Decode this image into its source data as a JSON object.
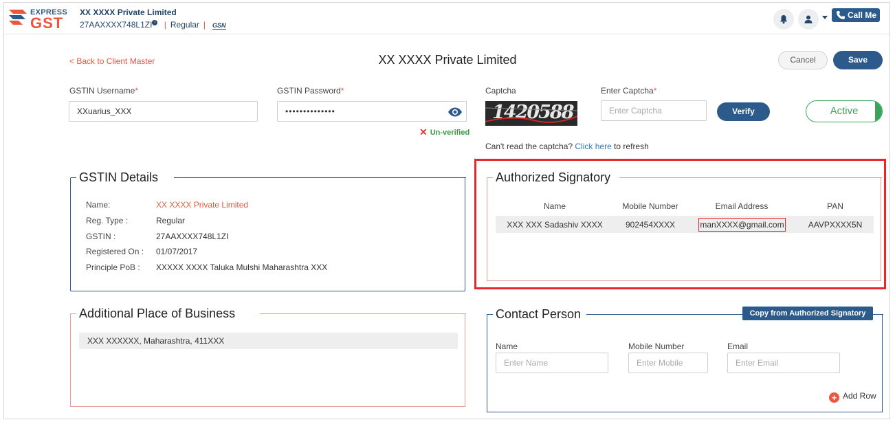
{
  "header": {
    "logo_top": "EXPRESS",
    "logo_bottom": "GST",
    "company": "XX XXXX Private Limited",
    "gstin": "27AAXXXX748L1ZI",
    "info_icon": "i",
    "reg_type": "Regular",
    "sep": "|",
    "gsn_badge": "GSN",
    "call_label": "Call Me",
    "colors": {
      "brand_blue": "#2c5a8a",
      "brand_orange": "#e9573f"
    }
  },
  "page": {
    "back_link": "< Back to Client Master",
    "title": "XX XXXX Private Limited",
    "cancel": "Cancel",
    "save": "Save"
  },
  "credentials": {
    "username_label": "GSTIN Username",
    "username_value": "XXuarius_XXX",
    "password_label": "GSTIN Password",
    "password_value": "••••••••••••••",
    "required_mark": "*",
    "unverified_icon": "✕",
    "unverified_text": "Un-verified",
    "captcha_label": "Captcha",
    "captcha_text": "1420588",
    "enter_captcha_label": "Enter Captcha",
    "enter_captcha_placeholder": "Enter Captcha",
    "verify": "Verify",
    "status": "Active",
    "refresh_prefix": "Can't read the captcha?",
    "refresh_link": "Click here",
    "refresh_suffix": "to refresh"
  },
  "gstin_details": {
    "title": "GSTIN Details",
    "rows": [
      {
        "label": "Name:",
        "value": "XX XXXX Private Limited"
      },
      {
        "label": "Reg. Type :",
        "value": "Regular"
      },
      {
        "label": "GSTIN :",
        "value": "27AAXXXX748L1ZI"
      },
      {
        "label": "Registered On :",
        "value": "01/07/2017"
      },
      {
        "label": "Principle PoB :",
        "value": "XXXXX XXXX Taluka Mulshi Maharashtra XXX"
      }
    ]
  },
  "additional_place": {
    "title": "Additional Place of Business",
    "rows": [
      "XXX XXXXXX, Maharashtra, 411XXX"
    ]
  },
  "authorized_signatory": {
    "title": "Authorized Signatory",
    "columns": [
      "Name",
      "Mobile Number",
      "Email Address",
      "PAN"
    ],
    "row": {
      "name": "XXX XXX Sadashiv XXXX",
      "mobile": "902454XXXX",
      "email": "manXXXX@gmail.com",
      "pan": "AAVPXXXX5N"
    }
  },
  "contact_person": {
    "title": "Contact Person",
    "copy_button": "Copy from Authorized Signatory",
    "name_label": "Name",
    "name_placeholder": "Enter Name",
    "mobile_label": "Mobile Number",
    "mobile_placeholder": "Enter Mobile",
    "email_label": "Email",
    "email_placeholder": "Enter Email",
    "add_row": "Add Row",
    "add_icon": "+"
  }
}
